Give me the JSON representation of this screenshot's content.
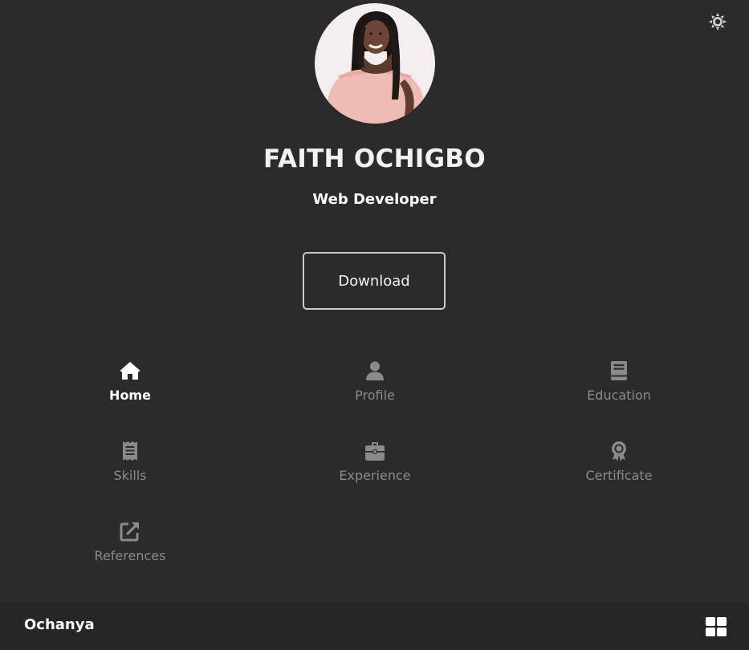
{
  "colors": {
    "background": "#2b2b2b",
    "footer_background": "#262626",
    "text_primary": "#ffffff",
    "text_muted": "#8a8a8a",
    "button_border": "#c9c9c9"
  },
  "header": {
    "theme_toggle_icon": "sun-icon"
  },
  "profile": {
    "name": "FAITH OCHIGBO",
    "title": "Web Developer",
    "download_label": "Download"
  },
  "nav": {
    "items": [
      {
        "label": "Home",
        "icon": "home-icon",
        "active": true
      },
      {
        "label": "Profile",
        "icon": "user-icon",
        "active": false
      },
      {
        "label": "Education",
        "icon": "book-icon",
        "active": false
      },
      {
        "label": "Skills",
        "icon": "receipt-icon",
        "active": false
      },
      {
        "label": "Experience",
        "icon": "briefcase-icon",
        "active": false
      },
      {
        "label": "Certificate",
        "icon": "award-icon",
        "active": false
      },
      {
        "label": "References",
        "icon": "external-link-icon",
        "active": false
      }
    ]
  },
  "footer": {
    "brand": "Ochanya",
    "menu_icon": "grid-icon"
  }
}
